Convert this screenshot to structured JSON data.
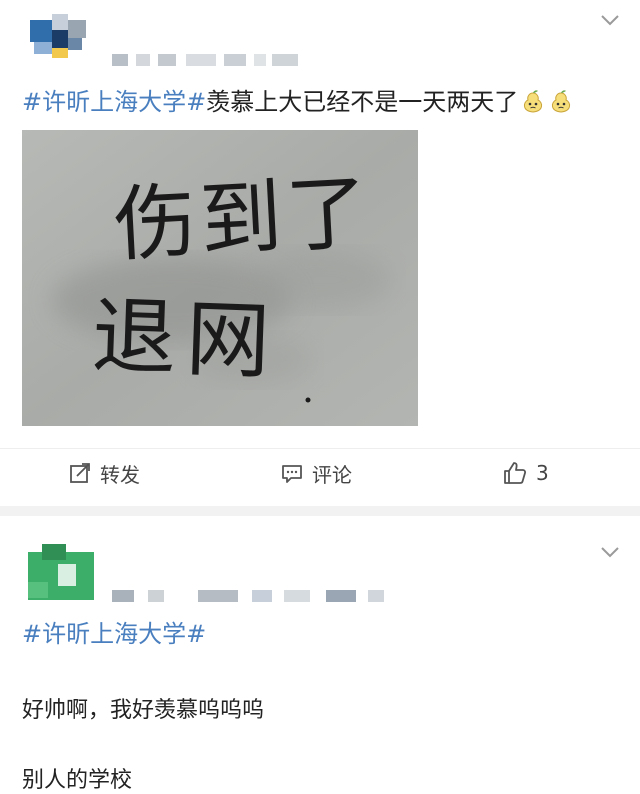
{
  "post1": {
    "hashtag": "#许昕上海大学#",
    "text": "羡慕上大已经不是一天两天了",
    "emojis": [
      "pear-face-emoji",
      "pear-face-emoji"
    ],
    "image_text": {
      "line1": "伤到了",
      "line2": "退网"
    },
    "actions": {
      "repost_label": "转发",
      "comment_label": "评论",
      "like_count": "3"
    }
  },
  "post2": {
    "hashtag": "#许昕上海大学#",
    "line1": "好帅啊，我好羡慕呜呜呜",
    "line2": "别人的学校"
  },
  "colors": {
    "hashtag": "#4a7fbf",
    "divider": "#f2f2f2",
    "avatar1": [
      "#2f6dab",
      "#1b3c66",
      "#6b87a8"
    ],
    "avatar2": "#3cae6a"
  }
}
